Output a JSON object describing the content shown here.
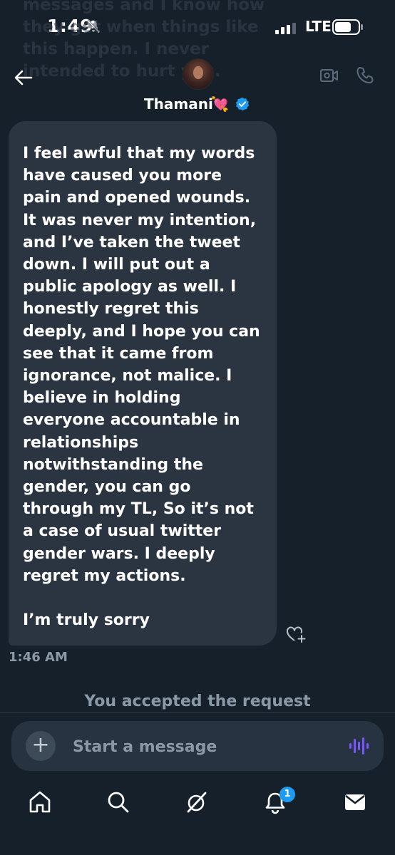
{
  "status_bar": {
    "time": "1:49",
    "network": "LTE"
  },
  "ghost_text": "messages and I know how they get when things like this happen. I never intended to hurt you.",
  "header": {
    "name": "Thamani",
    "name_emoji": "💘"
  },
  "message": {
    "text": "I feel awful that my words\nhave caused you more\npain and opened wounds.\nIt was never my intention,\nand I’ve taken the tweet\ndown. I will put out a\npublic apology as well. I\nhonestly regret this\ndeeply, and I hope you can\nsee that it came from\nignorance, not malice. I\nbelieve in holding\neveryone accountable in\nrelationships\nnotwithstanding the\ngender, you can go\nthrough my TL, So it’s not\na case of usual twitter\ngender wars. I deeply\nregret my actions.\n\nI’m truly sorry",
    "time": "1:46 AM"
  },
  "system_notice": "You accepted the request",
  "composer": {
    "placeholder": "Start a message",
    "plus": "+"
  },
  "tabbar": {
    "notifications_badge": "1"
  },
  "colors": {
    "background": "#15202b",
    "bubble": "#2b3542",
    "accent": "#1d9bf0",
    "voice": "#7856ff",
    "muted": "#8b98a5"
  }
}
